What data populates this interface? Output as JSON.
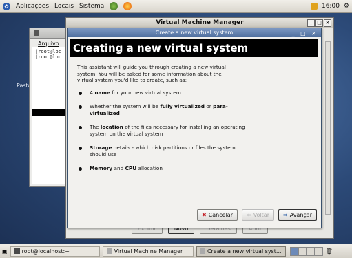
{
  "top_panel": {
    "menus": [
      "Aplicações",
      "Locais",
      "Sistema"
    ],
    "clock": "16:00"
  },
  "desktop": {
    "label": "Pasta"
  },
  "terminal": {
    "menu": "Arquivo",
    "lines": [
      "[root@loc",
      "[root@loc"
    ]
  },
  "vmm": {
    "title": "Virtual Machine Manager",
    "buttons": {
      "delete": "Excluir",
      "new": "Novo",
      "details": "Detalhes",
      "open": "Abrir"
    }
  },
  "wizard": {
    "title": "Create a new virtual system",
    "heading": "Creating a new virtual system",
    "intro": "This assistant will guide you through creating a new virtual system. You will be asked for some information about the virtual system you'd like to create, such as:",
    "points": [
      {
        "pre": "A ",
        "bold": "name",
        "post": " for your new virtual system"
      },
      {
        "pre": "Whether the system will be ",
        "bold": "fully virtualized",
        "mid": " or ",
        "bold2": "para-virtualized",
        "post": ""
      },
      {
        "pre": "The ",
        "bold": "location",
        "post": " of the files necessary for installing an operating system on the virtual system"
      },
      {
        "pre": "",
        "bold": "Storage",
        "post": " details - which disk partitions or files the system should use"
      },
      {
        "pre": "",
        "bold": "Memory",
        "mid": " and ",
        "bold2": "CPU",
        "post": " allocation"
      }
    ],
    "buttons": {
      "cancel": "Cancelar",
      "back": "Voltar",
      "forward": "Avançar"
    }
  },
  "taskbar": {
    "tasks": [
      "root@localhost:~",
      "Virtual Machine Manager",
      "Create a new virtual syst..."
    ]
  },
  "colors": {
    "desktop": "#2c4a78",
    "titlebar_active": "#5a77a6",
    "banner": "#000000"
  }
}
